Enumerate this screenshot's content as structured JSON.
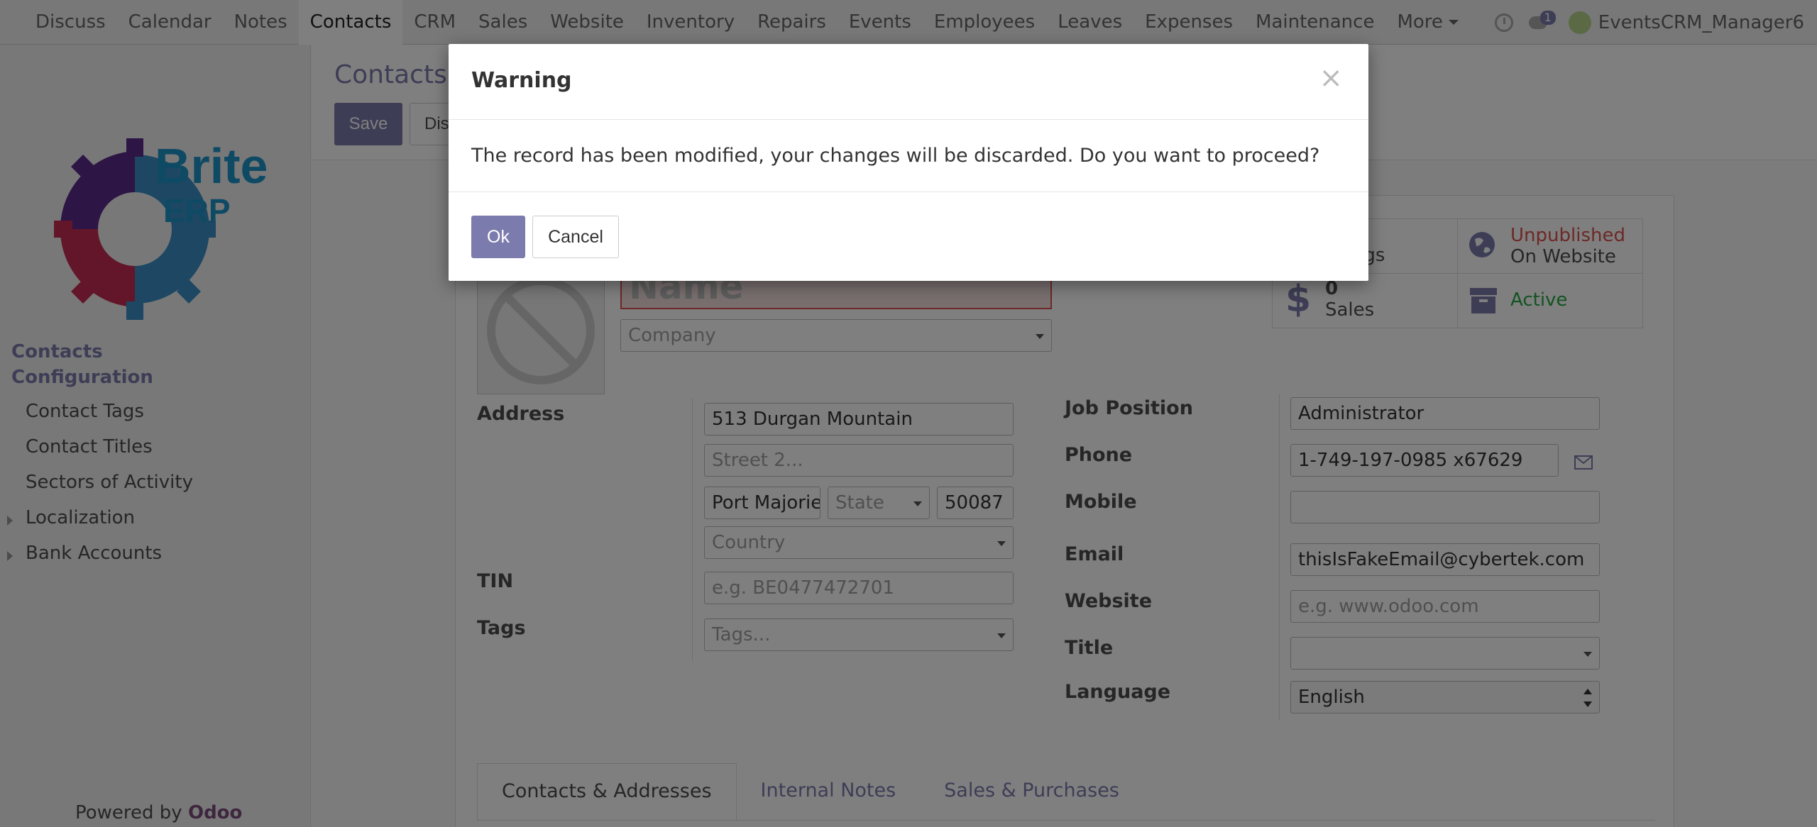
{
  "navbar": {
    "menu": [
      "Discuss",
      "Calendar",
      "Notes",
      "Contacts",
      "CRM",
      "Sales",
      "Website",
      "Inventory",
      "Repairs",
      "Events",
      "Employees",
      "Leaves",
      "Expenses",
      "Maintenance"
    ],
    "active": "Contacts",
    "more_label": "More",
    "chat_badge": "1",
    "user_name": "EventsCRM_Manager6"
  },
  "sidebar": {
    "logo_text_top": "Brite",
    "logo_text_bottom": "ERP",
    "section_contacts": "Contacts",
    "section_configuration": "Configuration",
    "items": [
      "Contact Tags",
      "Contact Titles",
      "Sectors of Activity",
      "Localization",
      "Bank Accounts"
    ],
    "powered_by": "Powered by",
    "powered_brand": "Odoo"
  },
  "control_panel": {
    "breadcrumb": "Contacts",
    "save_label": "Save",
    "discard_label": "Discard"
  },
  "form": {
    "name_placeholder": "Name",
    "company_placeholder": "Company",
    "stats": {
      "meetings_label": "Meetings",
      "website_status": "Unpublished",
      "website_sub": "On Website",
      "sales_count": "0",
      "sales_label": "Sales",
      "active_label": "Active"
    },
    "labels": {
      "address": "Address",
      "tin": "TIN",
      "tags": "Tags",
      "job_position": "Job Position",
      "phone": "Phone",
      "mobile": "Mobile",
      "email": "Email",
      "website": "Website",
      "title": "Title",
      "language": "Language"
    },
    "values": {
      "street": "513 Durgan Mountain",
      "street2_placeholder": "Street 2...",
      "city": "Port Majorie",
      "state_placeholder": "State",
      "zip": "50087",
      "country_placeholder": "Country",
      "tin_placeholder": "e.g. BE0477472701",
      "tags_placeholder": "Tags...",
      "job_position": "Administrator",
      "phone": "1-749-197-0985 x67629",
      "mobile": "",
      "email": "thisIsFakeEmail@cybertek.com",
      "website_placeholder": "e.g. www.odoo.com",
      "title": "",
      "language": "English"
    },
    "tabs": [
      "Contacts & Addresses",
      "Internal Notes",
      "Sales & Purchases"
    ]
  },
  "dialog": {
    "title": "Warning",
    "close_glyph": "×",
    "message": "The record has been modified, your changes will be discarded. Do you want to proceed?",
    "ok_label": "Ok",
    "cancel_label": "Cancel"
  },
  "colors": {
    "primary": "#7c7bad",
    "required_border": "#d9534f",
    "unpublished": "#d9534f",
    "active": "#28a745"
  }
}
